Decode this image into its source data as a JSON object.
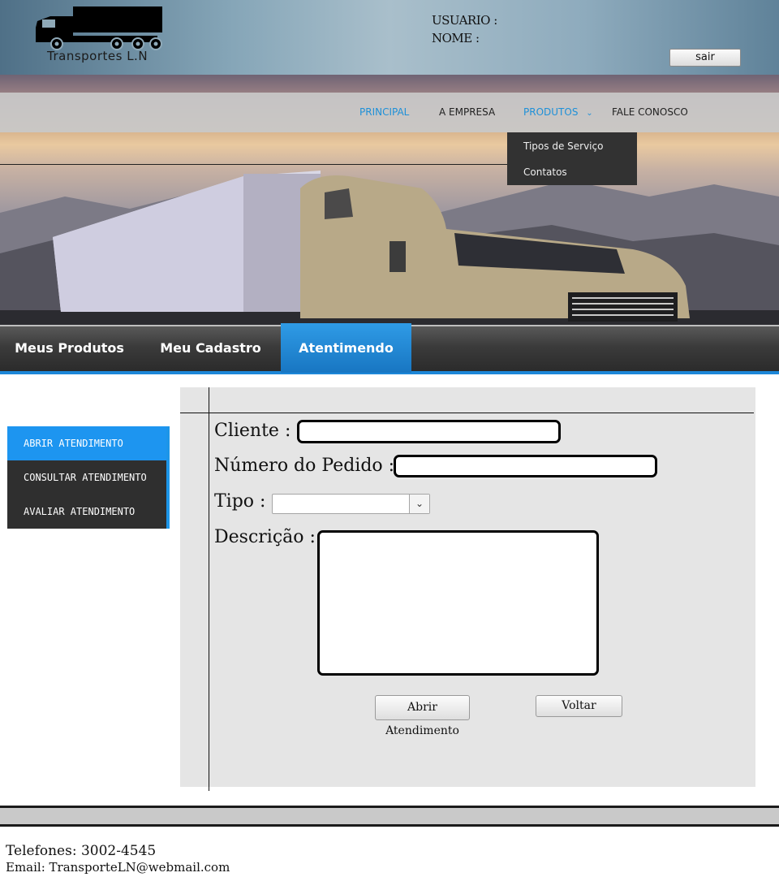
{
  "header": {
    "logo_text": "Transportes L.N",
    "user_label": "USUARIO :",
    "name_label": "NOME :",
    "logout_label": "sair"
  },
  "topnav": {
    "items": [
      {
        "label": "PRINCIPAL",
        "active": true
      },
      {
        "label": "A EMPRESA",
        "active": false
      },
      {
        "label": "PRODUTOS",
        "active": true
      },
      {
        "label": "FALE CONOSCO",
        "active": false
      }
    ],
    "dropdown": [
      "Tipos de Serviço",
      "Contatos"
    ],
    "active_color": "#1e90d8"
  },
  "tabs": [
    {
      "label": "Meus Produtos",
      "active": false
    },
    {
      "label": "Meu Cadastro",
      "active": false
    },
    {
      "label": "Atentimendo",
      "active": true
    }
  ],
  "sidemenu": {
    "items": [
      {
        "label": "ABRIR ATENDIMENTO",
        "active": true
      },
      {
        "label": "CONSULTAR ATENDIMENTO",
        "active": false
      },
      {
        "label": "AVALIAR ATENDIMENTO",
        "active": false
      }
    ],
    "accent": "#1d95f0"
  },
  "form": {
    "cliente_label": "Cliente :",
    "cliente_value": "",
    "pedido_label": "Número do Pedido :",
    "pedido_value": "",
    "tipo_label": "Tipo :",
    "tipo_value": "",
    "descricao_label": "Descrição :",
    "descricao_value": "",
    "submit_label": "Abrir Atendimento",
    "back_label": "Voltar"
  },
  "footer": {
    "phones": "Telefones: 3002-4545",
    "email": "Email: TransporteLN@webmail.com"
  }
}
